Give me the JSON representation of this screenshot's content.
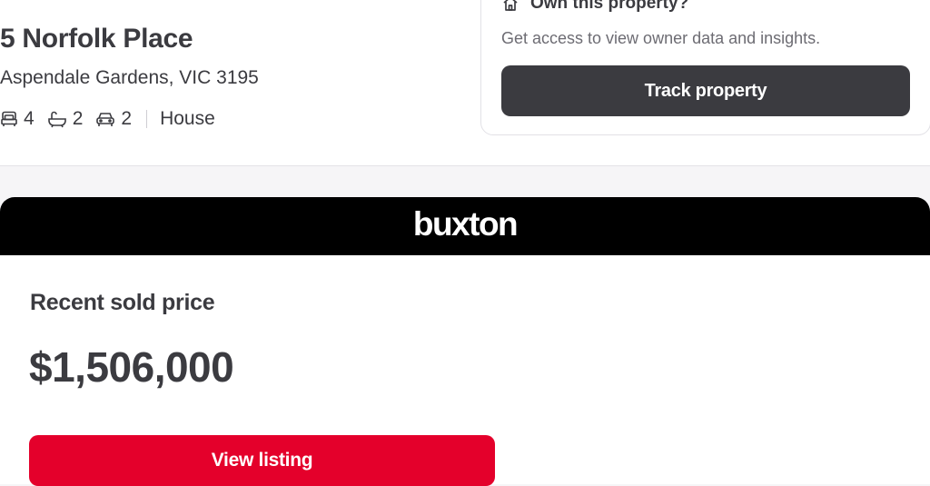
{
  "property": {
    "address": "5 Norfolk Place",
    "suburb": "Aspendale Gardens, VIC 3195",
    "bedrooms": "4",
    "bathrooms": "2",
    "car_spaces": "2",
    "property_type": "House"
  },
  "own_card": {
    "title": "Own this property?",
    "subtitle": "Get access to view owner data and insights.",
    "button_label": "Track property",
    "icon": "home-icon"
  },
  "agency": {
    "logo_text": "buxton",
    "banner_color": "#000000"
  },
  "sold": {
    "label": "Recent sold price",
    "price": "$1,506,000",
    "button_label": "View listing",
    "button_color": "#e4002b"
  },
  "colors": {
    "text": "#3b3b40",
    "dark_button": "#3b3b40",
    "accent": "#e4002b",
    "page_bg": "#f6f5f7"
  }
}
